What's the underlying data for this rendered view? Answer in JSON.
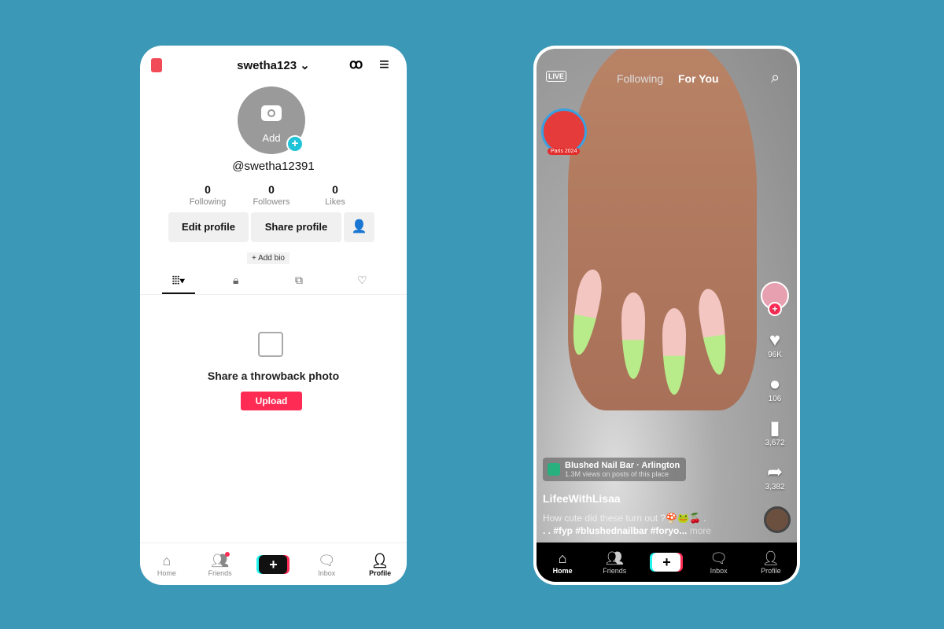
{
  "profile": {
    "username": "swetha123",
    "handle": "@swetha12391",
    "avatar_label": "Add",
    "stats": [
      {
        "value": "0",
        "label": "Following"
      },
      {
        "value": "0",
        "label": "Followers"
      },
      {
        "value": "0",
        "label": "Likes"
      }
    ],
    "edit_profile": "Edit profile",
    "share_profile": "Share profile",
    "add_bio": "+ Add bio",
    "empty_title": "Share a throwback photo",
    "upload": "Upload",
    "nav": [
      {
        "label": "Home",
        "icon": "home-icon"
      },
      {
        "label": "Friends",
        "icon": "friends-icon"
      },
      {
        "label": "+",
        "icon": "create-icon"
      },
      {
        "label": "Inbox",
        "icon": "inbox-icon"
      },
      {
        "label": "Profile",
        "icon": "profile-icon"
      }
    ],
    "accent": "#fe2c55"
  },
  "feed": {
    "live": "LIVE",
    "tabs": [
      "Following",
      "For You"
    ],
    "badge": "Paris 2024",
    "actions": [
      {
        "icon": "heart-icon",
        "count": "96K"
      },
      {
        "icon": "comment-icon",
        "count": "106"
      },
      {
        "icon": "bookmark-icon",
        "count": "3,672"
      },
      {
        "icon": "share-icon",
        "count": "3,382"
      }
    ],
    "location": {
      "name": "Blushed Nail Bar · Arlington",
      "sub": "1.3M views on posts of this place"
    },
    "author": "LifeeWithLisaa",
    "caption1": "How cute did these turn out ?🍄🐸🍒 .",
    "caption2": ". . #fyp #blushednailbar #foryo...",
    "more": "more",
    "nav": [
      {
        "label": "Home"
      },
      {
        "label": "Friends"
      },
      {
        "label": "+"
      },
      {
        "label": "Inbox"
      },
      {
        "label": "Profile"
      }
    ]
  }
}
